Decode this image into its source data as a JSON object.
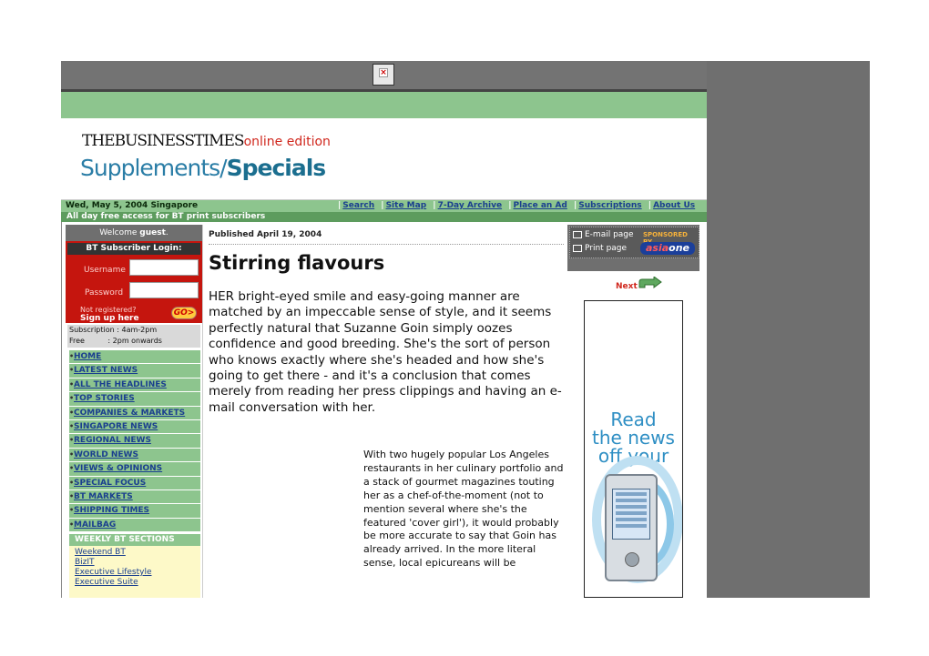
{
  "close_icon": "close-x-icon",
  "header": {
    "brand_line": "THEBUSINESSTIMES",
    "brand_suffix": "online edition",
    "section_part1": "Supplements/",
    "section_part2": "Specials"
  },
  "navbar": {
    "date": "Wed, May 5, 2004 Singapore",
    "links": [
      "Search",
      "Site Map",
      "7-Day Archive",
      "Place an Ad",
      "Subscriptions",
      "About Us"
    ]
  },
  "free_access": "All day free access for BT print subscribers",
  "sidebar": {
    "welcome_prefix": "Welcome",
    "welcome_user": "guest",
    "login_title": "BT Subscriber Login:",
    "username_label": "Username",
    "password_label": "Password",
    "not_registered": "Not registered?",
    "signup": "Sign up here",
    "go_label": "GO>",
    "subscription_line": "Subscription : 4am-2pm",
    "free_line": "Free          : 2pm onwards",
    "menu": [
      "HOME",
      "LATEST NEWS",
      "ALL THE HEADLINES",
      "TOP STORIES",
      "COMPANIES & MARKETS",
      "SINGAPORE NEWS",
      "REGIONAL NEWS",
      "WORLD NEWS",
      "VIEWS & OPINIONS",
      "SPECIAL FOCUS",
      "BT MARKETS",
      "SHIPPING TIMES",
      "MAILBAG"
    ],
    "weekly_title": "WEEKLY BT SECTIONS",
    "weekly_links": [
      "Weekend BT",
      "BizIT",
      "Executive Lifestyle",
      "Executive Suite"
    ]
  },
  "article": {
    "published": "Published April 19, 2004",
    "headline": "Stirring flavours",
    "lead": "HER bright-eyed smile and easy-going manner are matched by an impeccable sense of style, and it seems perfectly natural that Suzanne Goin simply oozes confidence and good breeding. She's the sort of person who knows exactly where she's headed and how she's going to get there - and it's a conclusion that comes merely from reading her press clippings and having an e-mail conversation with her.",
    "body": "With two hugely popular Los Angeles restaurants in her culinary portfolio and a stack of gourmet magazines touting her as a chef-of-the-moment (not to mention several where she's the featured 'cover girl'), it would probably be more accurate to say that Goin has already arrived. In the more literal sense, local epicureans will be"
  },
  "tools": {
    "email_page": "E-mail page",
    "print_page": "Print page",
    "sponsored_by": "SPONSORED BY",
    "sponsor_brand_a": "asia",
    "sponsor_brand_b": "one"
  },
  "next_label": "Next",
  "ad": {
    "line1": "Read",
    "line2": "the news",
    "line3": "off your"
  }
}
